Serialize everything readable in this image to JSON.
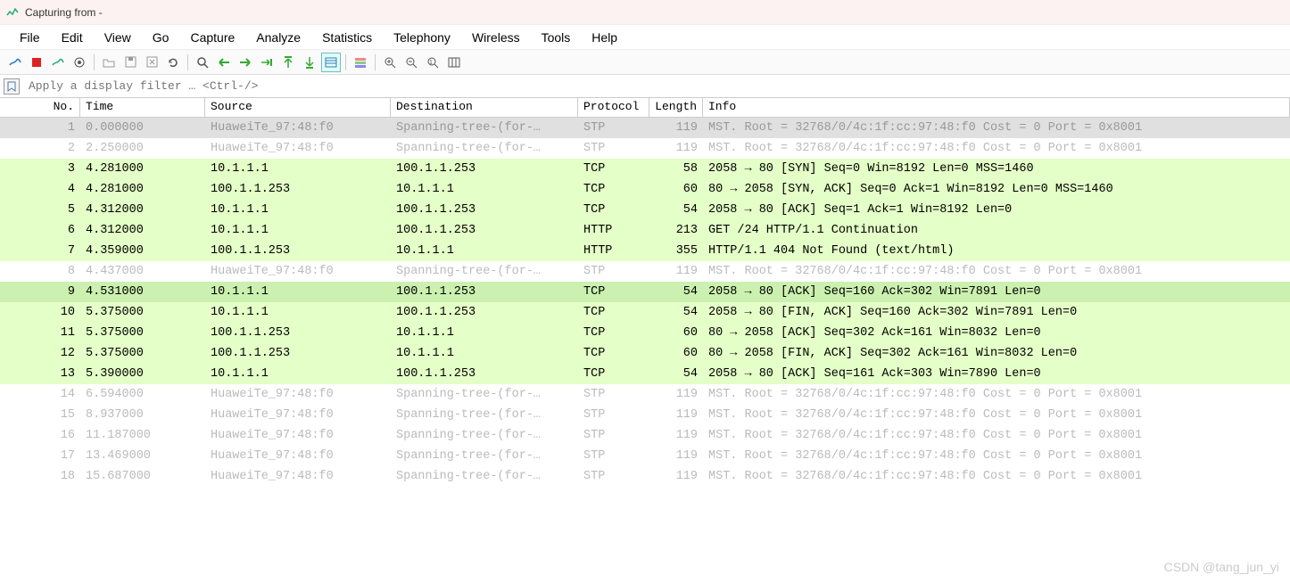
{
  "window": {
    "title": "Capturing from -"
  },
  "menu": [
    "File",
    "Edit",
    "View",
    "Go",
    "Capture",
    "Analyze",
    "Statistics",
    "Telephony",
    "Wireless",
    "Tools",
    "Help"
  ],
  "filter": {
    "placeholder": "Apply a display filter … <Ctrl-/>"
  },
  "columns": {
    "no": "No.",
    "time": "Time",
    "source": "Source",
    "destination": "Destination",
    "protocol": "Protocol",
    "length": "Length",
    "info": "Info"
  },
  "packets": [
    {
      "no": "1",
      "time": "0.000000",
      "src": "HuaweiTe_97:48:f0",
      "dst": "Spanning-tree-(for-…",
      "proto": "STP",
      "len": "119",
      "info": "MST. Root = 32768/0/4c:1f:cc:97:48:f0  Cost = 0  Port = 0x8001",
      "style": "gray"
    },
    {
      "no": "2",
      "time": "2.250000",
      "src": "HuaweiTe_97:48:f0",
      "dst": "Spanning-tree-(for-…",
      "proto": "STP",
      "len": "119",
      "info": "MST. Root = 32768/0/4c:1f:cc:97:48:f0  Cost = 0  Port = 0x8001",
      "style": "faded"
    },
    {
      "no": "3",
      "time": "4.281000",
      "src": "10.1.1.1",
      "dst": "100.1.1.253",
      "proto": "TCP",
      "len": "58",
      "info": "2058 → 80 [SYN] Seq=0 Win=8192 Len=0 MSS=1460",
      "style": "green"
    },
    {
      "no": "4",
      "time": "4.281000",
      "src": "100.1.1.253",
      "dst": "10.1.1.1",
      "proto": "TCP",
      "len": "60",
      "info": "80 → 2058 [SYN, ACK] Seq=0 Ack=1 Win=8192 Len=0 MSS=1460",
      "style": "green"
    },
    {
      "no": "5",
      "time": "4.312000",
      "src": "10.1.1.1",
      "dst": "100.1.1.253",
      "proto": "TCP",
      "len": "54",
      "info": "2058 → 80 [ACK] Seq=1 Ack=1 Win=8192 Len=0",
      "style": "green"
    },
    {
      "no": "6",
      "time": "4.312000",
      "src": "10.1.1.1",
      "dst": "100.1.1.253",
      "proto": "HTTP",
      "len": "213",
      "info": "GET /24 HTTP/1.1 Continuation",
      "style": "green"
    },
    {
      "no": "7",
      "time": "4.359000",
      "src": "100.1.1.253",
      "dst": "10.1.1.1",
      "proto": "HTTP",
      "len": "355",
      "info": "HTTP/1.1 404 Not Found  (text/html)",
      "style": "green"
    },
    {
      "no": "8",
      "time": "4.437000",
      "src": "HuaweiTe_97:48:f0",
      "dst": "Spanning-tree-(for-…",
      "proto": "STP",
      "len": "119",
      "info": "MST. Root = 32768/0/4c:1f:cc:97:48:f0  Cost = 0  Port = 0x8001",
      "style": "faded"
    },
    {
      "no": "9",
      "time": "4.531000",
      "src": "10.1.1.1",
      "dst": "100.1.1.253",
      "proto": "TCP",
      "len": "54",
      "info": "2058 → 80 [ACK] Seq=160 Ack=302 Win=7891 Len=0",
      "style": "green-sel"
    },
    {
      "no": "10",
      "time": "5.375000",
      "src": "10.1.1.1",
      "dst": "100.1.1.253",
      "proto": "TCP",
      "len": "54",
      "info": "2058 → 80 [FIN, ACK] Seq=160 Ack=302 Win=7891 Len=0",
      "style": "green"
    },
    {
      "no": "11",
      "time": "5.375000",
      "src": "100.1.1.253",
      "dst": "10.1.1.1",
      "proto": "TCP",
      "len": "60",
      "info": "80 → 2058 [ACK] Seq=302 Ack=161 Win=8032 Len=0",
      "style": "green"
    },
    {
      "no": "12",
      "time": "5.375000",
      "src": "100.1.1.253",
      "dst": "10.1.1.1",
      "proto": "TCP",
      "len": "60",
      "info": "80 → 2058 [FIN, ACK] Seq=302 Ack=161 Win=8032 Len=0",
      "style": "green"
    },
    {
      "no": "13",
      "time": "5.390000",
      "src": "10.1.1.1",
      "dst": "100.1.1.253",
      "proto": "TCP",
      "len": "54",
      "info": "2058 → 80 [ACK] Seq=161 Ack=303 Win=7890 Len=0",
      "style": "green"
    },
    {
      "no": "14",
      "time": "6.594000",
      "src": "HuaweiTe_97:48:f0",
      "dst": "Spanning-tree-(for-…",
      "proto": "STP",
      "len": "119",
      "info": "MST. Root = 32768/0/4c:1f:cc:97:48:f0  Cost = 0  Port = 0x8001",
      "style": "faded"
    },
    {
      "no": "15",
      "time": "8.937000",
      "src": "HuaweiTe_97:48:f0",
      "dst": "Spanning-tree-(for-…",
      "proto": "STP",
      "len": "119",
      "info": "MST. Root = 32768/0/4c:1f:cc:97:48:f0  Cost = 0  Port = 0x8001",
      "style": "faded"
    },
    {
      "no": "16",
      "time": "11.187000",
      "src": "HuaweiTe_97:48:f0",
      "dst": "Spanning-tree-(for-…",
      "proto": "STP",
      "len": "119",
      "info": "MST. Root = 32768/0/4c:1f:cc:97:48:f0  Cost = 0  Port = 0x8001",
      "style": "faded"
    },
    {
      "no": "17",
      "time": "13.469000",
      "src": "HuaweiTe_97:48:f0",
      "dst": "Spanning-tree-(for-…",
      "proto": "STP",
      "len": "119",
      "info": "MST. Root = 32768/0/4c:1f:cc:97:48:f0  Cost = 0  Port = 0x8001",
      "style": "faded"
    },
    {
      "no": "18",
      "time": "15.687000",
      "src": "HuaweiTe_97:48:f0",
      "dst": "Spanning-tree-(for-…",
      "proto": "STP",
      "len": "119",
      "info": "MST. Root = 32768/0/4c:1f:cc:97:48:f0  Cost = 0  Port = 0x8001",
      "style": "faded"
    }
  ],
  "watermark": "CSDN @tang_jun_yi"
}
